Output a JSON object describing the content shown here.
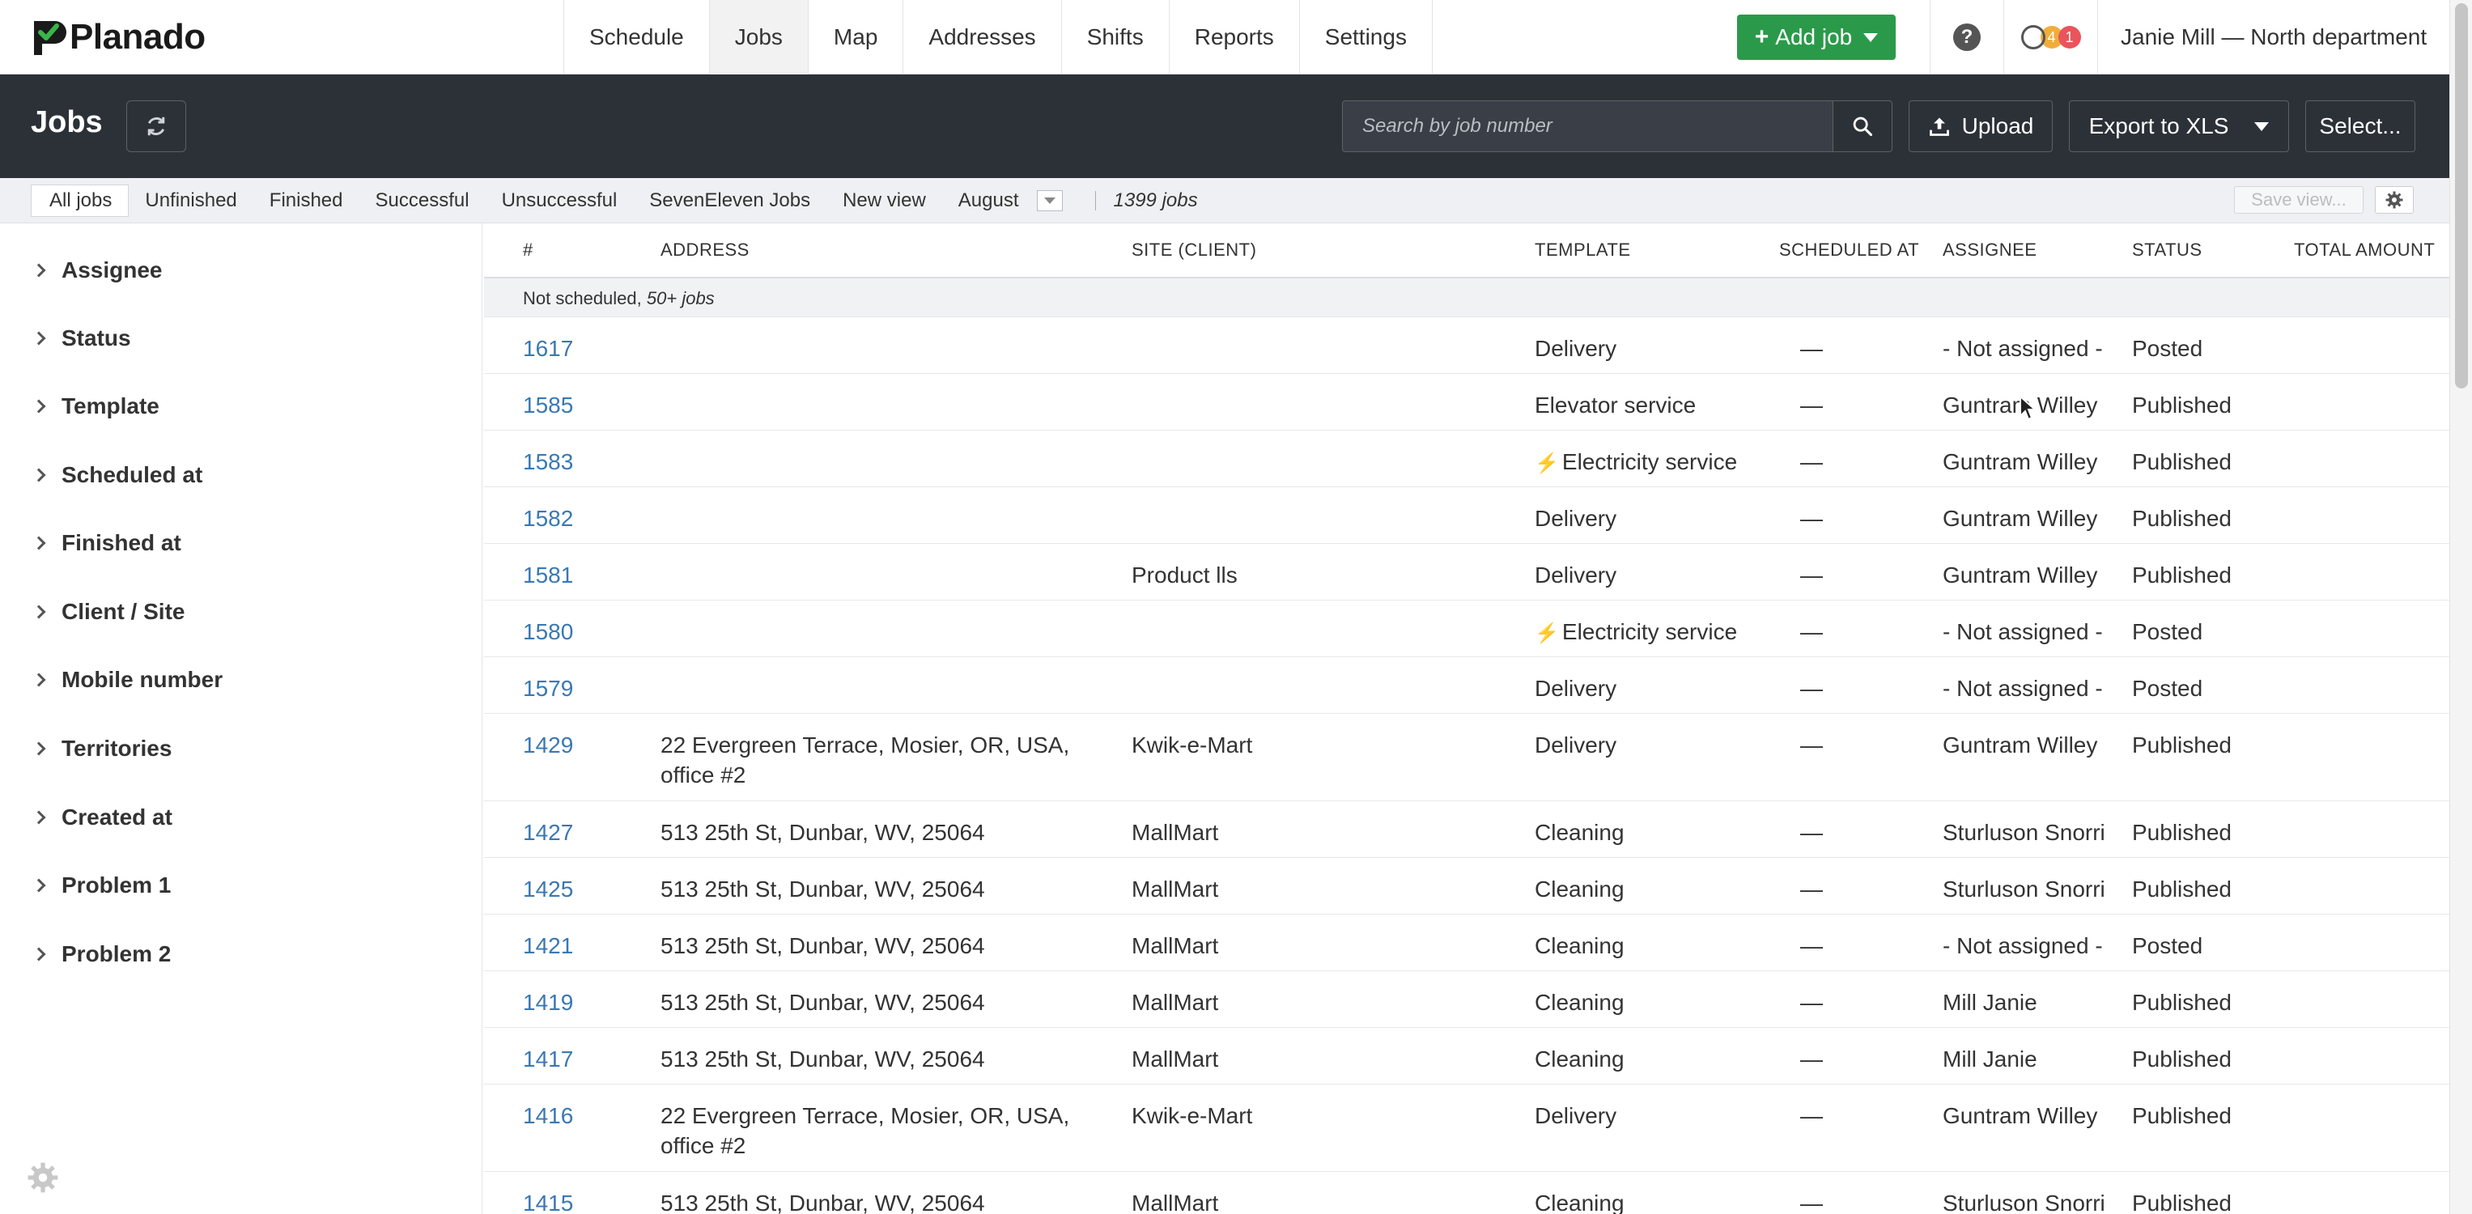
{
  "app": {
    "name": "Planado"
  },
  "nav": {
    "tabs": [
      "Schedule",
      "Jobs",
      "Map",
      "Addresses",
      "Shifts",
      "Reports",
      "Settings"
    ],
    "add_job_label": "Add job",
    "notifications": {
      "count_1": "4",
      "count_2": "1"
    },
    "user": "Janie Mill — North department"
  },
  "header": {
    "title": "Jobs",
    "search_placeholder": "Search by job number",
    "upload_label": "Upload",
    "export_label": "Export to XLS",
    "select_label": "Select..."
  },
  "views": {
    "tabs": [
      "All jobs",
      "Unfinished",
      "Finished",
      "Successful",
      "Unsuccessful",
      "SevenEleven Jobs",
      "New view",
      "August"
    ],
    "active": "All jobs",
    "count": "1399 jobs",
    "save_view_label": "Save view..."
  },
  "sidebar": {
    "facets": [
      "Assignee",
      "Status",
      "Template",
      "Scheduled at",
      "Finished at",
      "Client / Site",
      "Mobile number",
      "Territories",
      "Created at",
      "Problem 1",
      "Problem 2"
    ]
  },
  "table": {
    "columns": [
      "#",
      "ADDRESS",
      "SITE (CLIENT)",
      "TEMPLATE",
      "SCHEDULED AT",
      "ASSIGNEE",
      "STATUS",
      "TOTAL AMOUNT"
    ],
    "group": {
      "label": "Not scheduled,",
      "count": "50+ jobs"
    },
    "rows": [
      {
        "num": "1617",
        "address": "",
        "site": "",
        "template": "Delivery",
        "bolt": false,
        "scheduled": "—",
        "assignee": "- Not assigned -",
        "status": "Posted"
      },
      {
        "num": "1585",
        "address": "",
        "site": "",
        "template": "Elevator service",
        "bolt": false,
        "scheduled": "—",
        "assignee": "Guntram Willey",
        "status": "Published"
      },
      {
        "num": "1583",
        "address": "",
        "site": "",
        "template": "Electricity service",
        "bolt": true,
        "scheduled": "—",
        "assignee": "Guntram Willey",
        "status": "Published"
      },
      {
        "num": "1582",
        "address": "",
        "site": "",
        "template": "Delivery",
        "bolt": false,
        "scheduled": "—",
        "assignee": "Guntram Willey",
        "status": "Published"
      },
      {
        "num": "1581",
        "address": "",
        "site": "Product lls",
        "template": "Delivery",
        "bolt": false,
        "scheduled": "—",
        "assignee": "Guntram Willey",
        "status": "Published"
      },
      {
        "num": "1580",
        "address": "",
        "site": "",
        "template": "Electricity service",
        "bolt": true,
        "scheduled": "—",
        "assignee": "- Not assigned -",
        "status": "Posted"
      },
      {
        "num": "1579",
        "address": "",
        "site": "",
        "template": "Delivery",
        "bolt": false,
        "scheduled": "—",
        "assignee": "- Not assigned -",
        "status": "Posted"
      },
      {
        "num": "1429",
        "address": "22 Evergreen Terrace, Mosier, OR, USA, office #2",
        "site": "Kwik-e-Mart",
        "template": "Delivery",
        "bolt": false,
        "scheduled": "—",
        "assignee": "Guntram Willey",
        "status": "Published"
      },
      {
        "num": "1427",
        "address": "513 25th St, Dunbar, WV, 25064",
        "site": "MallMart",
        "template": "Cleaning",
        "bolt": false,
        "scheduled": "—",
        "assignee": "Sturluson Snorri",
        "status": "Published"
      },
      {
        "num": "1425",
        "address": "513 25th St, Dunbar, WV, 25064",
        "site": "MallMart",
        "template": "Cleaning",
        "bolt": false,
        "scheduled": "—",
        "assignee": "Sturluson Snorri",
        "status": "Published"
      },
      {
        "num": "1421",
        "address": "513 25th St, Dunbar, WV, 25064",
        "site": "MallMart",
        "template": "Cleaning",
        "bolt": false,
        "scheduled": "—",
        "assignee": "- Not assigned -",
        "status": "Posted"
      },
      {
        "num": "1419",
        "address": "513 25th St, Dunbar, WV, 25064",
        "site": "MallMart",
        "template": "Cleaning",
        "bolt": false,
        "scheduled": "—",
        "assignee": "Mill Janie",
        "status": "Published"
      },
      {
        "num": "1417",
        "address": "513 25th St, Dunbar, WV, 25064",
        "site": "MallMart",
        "template": "Cleaning",
        "bolt": false,
        "scheduled": "—",
        "assignee": "Mill Janie",
        "status": "Published"
      },
      {
        "num": "1416",
        "address": "22 Evergreen Terrace, Mosier, OR, USA, office #2",
        "site": "Kwik-e-Mart",
        "template": "Delivery",
        "bolt": false,
        "scheduled": "—",
        "assignee": "Guntram Willey",
        "status": "Published"
      },
      {
        "num": "1415",
        "address": "513 25th St, Dunbar, WV, 25064",
        "site": "MallMart",
        "template": "Cleaning",
        "bolt": false,
        "scheduled": "—",
        "assignee": "Sturluson Snorri",
        "status": "Published"
      }
    ]
  },
  "colors": {
    "accent_green": "#2a9a4a",
    "header_dark": "#2c3138",
    "link_blue": "#3a78b3",
    "bolt": "#f0a437"
  }
}
